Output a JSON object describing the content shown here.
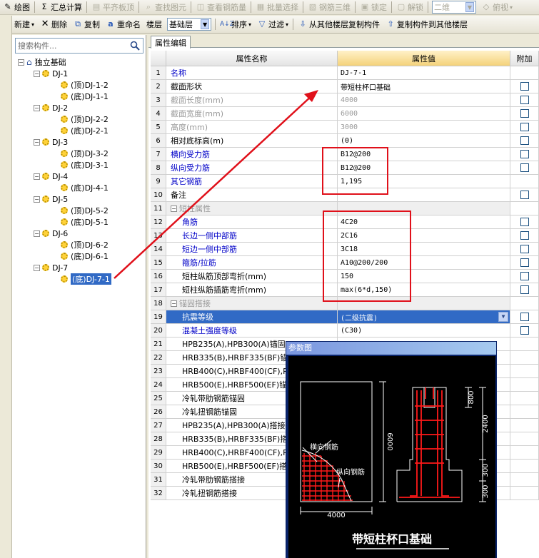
{
  "toolbar1": {
    "items": [
      {
        "label": "绘图",
        "icon": "pencil-icon",
        "enabled": true
      },
      {
        "label": "汇总计算",
        "icon": "sigma-icon",
        "enabled": true
      },
      {
        "label": "平齐板顶",
        "icon": "align-icon",
        "enabled": false
      },
      {
        "label": "查找图元",
        "icon": "search-icon",
        "enabled": false
      },
      {
        "label": "查看钢筋量",
        "icon": "view-rebar-icon",
        "enabled": false
      },
      {
        "label": "批量选择",
        "icon": "batch-select-icon",
        "enabled": false
      },
      {
        "label": "钢筋三维",
        "icon": "rebar-3d-icon",
        "enabled": false
      },
      {
        "label": "锁定",
        "icon": "lock-icon",
        "enabled": false
      },
      {
        "label": "解锁",
        "icon": "unlock-icon",
        "enabled": false
      }
    ],
    "view_mode": "二维",
    "view_angle": "俯视"
  },
  "toolbar2": {
    "new_label": "新建",
    "delete_label": "删除",
    "copy_label": "复制",
    "rename_label": "重命名",
    "floor_label": "楼层",
    "floor_value": "基础层",
    "sort_label": "排序",
    "filter_label": "过滤",
    "copy_from_floor_label": "从其他楼层复制构件",
    "copy_to_floor_label": "复制构件到其他楼层"
  },
  "left": {
    "search_placeholder": "搜索构件...",
    "root": "独立基础",
    "groups": [
      {
        "name": "DJ-1",
        "children": [
          "(顶)DJ-1-2",
          "(底)DJ-1-1"
        ]
      },
      {
        "name": "DJ-2",
        "children": [
          "(顶)DJ-2-2",
          "(底)DJ-2-1"
        ]
      },
      {
        "name": "DJ-3",
        "children": [
          "(顶)DJ-3-2",
          "(底)DJ-3-1"
        ]
      },
      {
        "name": "DJ-4",
        "children": [
          "(底)DJ-4-1"
        ]
      },
      {
        "name": "DJ-5",
        "children": [
          "(顶)DJ-5-2",
          "(底)DJ-5-1"
        ]
      },
      {
        "name": "DJ-6",
        "children": [
          "(顶)DJ-6-2",
          "(底)DJ-6-1"
        ]
      },
      {
        "name": "DJ-7",
        "children": [
          "(底)DJ-7-1"
        ]
      }
    ],
    "selected": "(底)DJ-7-1"
  },
  "tab": "属性编辑",
  "grid": {
    "headers": [
      "属性名称",
      "属性值",
      "附加"
    ],
    "rows": [
      {
        "n": "1",
        "name": "名称",
        "value": "DJ-7-1",
        "style": "blue",
        "check": false
      },
      {
        "n": "2",
        "name": "截面形状",
        "value": "带短柱杯口基础",
        "style": "normal",
        "check": true
      },
      {
        "n": "3",
        "name": "截面长度(mm)",
        "value": "4000",
        "style": "gray",
        "check": true
      },
      {
        "n": "4",
        "name": "截面宽度(mm)",
        "value": "6000",
        "style": "gray",
        "check": true
      },
      {
        "n": "5",
        "name": "高度(mm)",
        "value": "3000",
        "style": "gray",
        "check": true
      },
      {
        "n": "6",
        "name": "相对底标高(m)",
        "value": "(0)",
        "style": "normal",
        "check": true
      },
      {
        "n": "7",
        "name": "横向受力筋",
        "value": "B12@200",
        "style": "blue",
        "check": true
      },
      {
        "n": "8",
        "name": "纵向受力筋",
        "value": "B12@200",
        "style": "blue",
        "check": true
      },
      {
        "n": "9",
        "name": "其它钢筋",
        "value": "1,195",
        "style": "blue",
        "check": false
      },
      {
        "n": "10",
        "name": "备注",
        "value": "",
        "style": "normal",
        "check": true
      },
      {
        "n": "11",
        "name": "短柱属性",
        "value": "",
        "style": "group",
        "check": false
      },
      {
        "n": "12",
        "name": "角筋",
        "value": "4C20",
        "style": "blue-sub",
        "check": true
      },
      {
        "n": "13",
        "name": "长边一侧中部筋",
        "value": "2C16",
        "style": "blue-sub",
        "check": true
      },
      {
        "n": "14",
        "name": "短边一侧中部筋",
        "value": "3C18",
        "style": "blue-sub",
        "check": true
      },
      {
        "n": "15",
        "name": "箍筋/拉筋",
        "value": "A10@200/200",
        "style": "blue-sub",
        "check": true
      },
      {
        "n": "16",
        "name": "短柱纵筋顶部弯折(mm)",
        "value": "150",
        "style": "sub",
        "check": true
      },
      {
        "n": "17",
        "name": "短柱纵筋插筋弯折(mm)",
        "value": "max(6*d,150)",
        "style": "sub",
        "check": true
      },
      {
        "n": "18",
        "name": "锚固搭接",
        "value": "",
        "style": "group",
        "check": false
      },
      {
        "n": "19",
        "name": "抗震等级",
        "value": "(二级抗震)",
        "style": "selected",
        "check": true
      },
      {
        "n": "20",
        "name": "混凝土强度等级",
        "value": "(C30)",
        "style": "blue-sub",
        "check": true
      },
      {
        "n": "21",
        "name": "HPB235(A),HPB300(A)锚固",
        "value": "",
        "style": "sub",
        "check": false
      },
      {
        "n": "22",
        "name": "HRB335(B),HRBF335(BF)锚",
        "value": "",
        "style": "sub",
        "check": false
      },
      {
        "n": "23",
        "name": "HRB400(C),HRBF400(CF),R",
        "value": "",
        "style": "sub",
        "check": false
      },
      {
        "n": "24",
        "name": "HRB500(E),HRBF500(EF)锚",
        "value": "",
        "style": "sub",
        "check": false
      },
      {
        "n": "25",
        "name": "冷轧带肋钢筋锚固",
        "value": "",
        "style": "sub",
        "check": false
      },
      {
        "n": "26",
        "name": "冷轧扭钢筋锚固",
        "value": "",
        "style": "sub",
        "check": false
      },
      {
        "n": "27",
        "name": "HPB235(A),HPB300(A)搭接",
        "value": "",
        "style": "sub",
        "check": false
      },
      {
        "n": "28",
        "name": "HRB335(B),HRBF335(BF)搭",
        "value": "",
        "style": "sub",
        "check": false
      },
      {
        "n": "29",
        "name": "HRB400(C),HRBF400(CF),R",
        "value": "",
        "style": "sub",
        "check": false
      },
      {
        "n": "30",
        "name": "HRB500(E),HRBF500(EF)搭",
        "value": "",
        "style": "sub",
        "check": false
      },
      {
        "n": "31",
        "name": "冷轧带肋钢筋搭接",
        "value": "",
        "style": "sub",
        "check": false
      },
      {
        "n": "32",
        "name": "冷轧扭钢筋搭接",
        "value": "",
        "style": "sub",
        "check": false
      }
    ]
  },
  "param_window": {
    "title": "参数图",
    "label_heng": "横向钢筋",
    "label_zong": "纵向钢筋",
    "dim_width": "4000",
    "dim_height": "6000",
    "dim_800": "800",
    "dim_2400": "2400",
    "dim_300a": "300",
    "dim_300b": "300",
    "caption": "带短柱杯口基础"
  },
  "colors": {
    "highlight": "#e0101a",
    "selection": "#316ac5",
    "link_blue": "#0000c8"
  }
}
